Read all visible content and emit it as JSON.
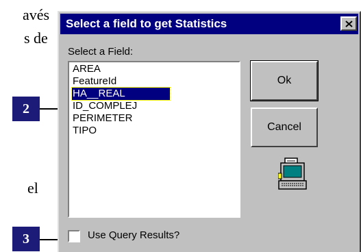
{
  "background_text": {
    "line1": "avés",
    "line2": "s de",
    "line3": "el"
  },
  "callouts": {
    "c2": "2",
    "c3": "3"
  },
  "dialog": {
    "title": "Select a field to get Statistics",
    "close_icon": "close-icon",
    "field_label": "Select a Field:",
    "fields": [
      "AREA",
      "FeatureId",
      "HA__REAL",
      "ID_COMPLEJ",
      "PERIMETER",
      "TIPO"
    ],
    "selected_field": "HA__REAL",
    "ok_label": "Ok",
    "cancel_label": "Cancel",
    "use_query_label": "Use Query Results?",
    "use_query_checked": false,
    "icon": "computer-icon"
  },
  "colors": {
    "titlebar": "#000080",
    "selection": "#000080",
    "dialog_face": "#c0c0c0",
    "callout_box": "#1c1c78"
  }
}
